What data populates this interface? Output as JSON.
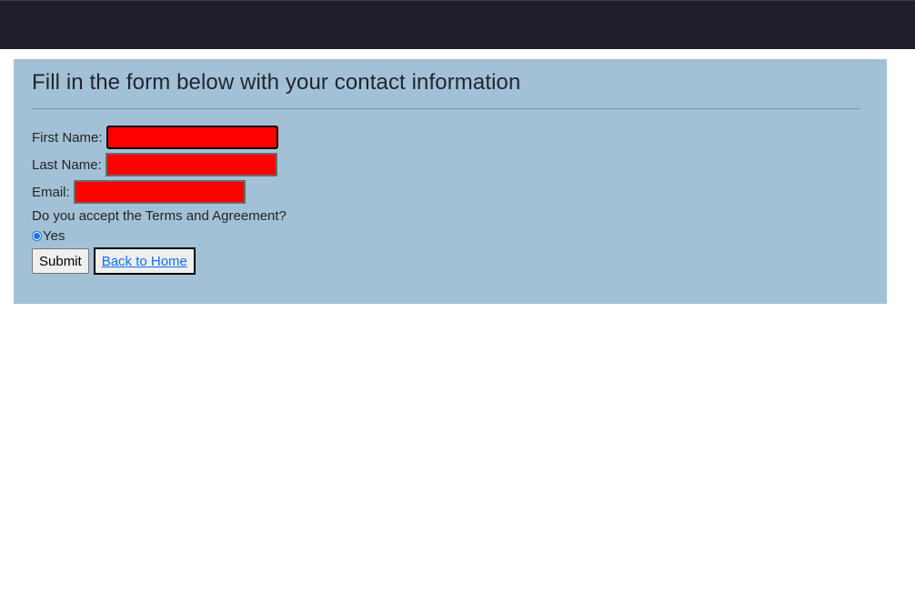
{
  "header": {
    "background": "#1f1e2b"
  },
  "form": {
    "title": "Fill in the form below with your contact information",
    "first_name_label": "First Name:",
    "first_name_value": "",
    "last_name_label": "Last Name:",
    "last_name_value": "",
    "email_label": "Email:",
    "email_value": "",
    "terms_question": "Do you accept the Terms and Agreement?",
    "terms_option": "Yes",
    "terms_selected": true,
    "submit_label": "Submit",
    "back_link_label": "Back to Home",
    "field_color": "#ff0000",
    "panel_color": "#a3c1d6",
    "link_color": "#0d6efd"
  }
}
